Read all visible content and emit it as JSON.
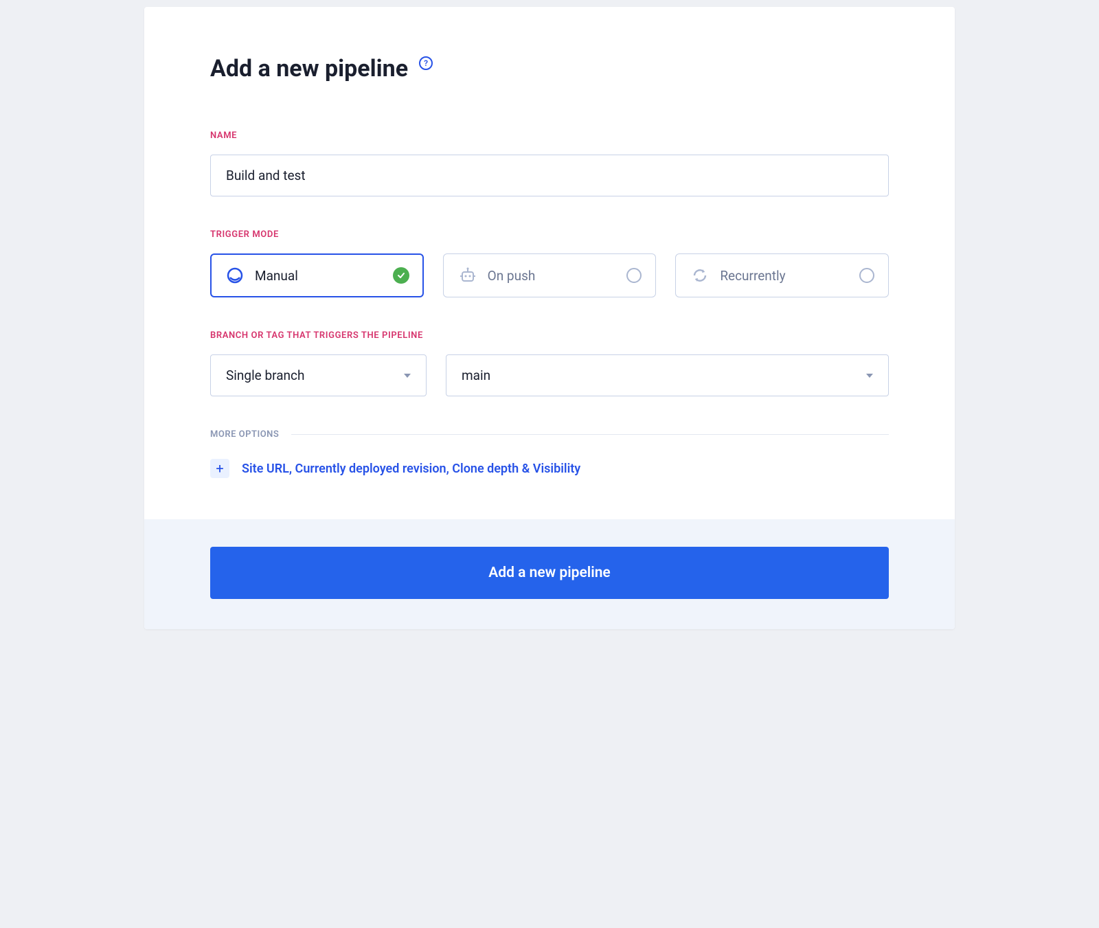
{
  "page_title": "Add a new pipeline",
  "sections": {
    "name": {
      "label": "NAME",
      "value": "Build and test"
    },
    "trigger_mode": {
      "label": "TRIGGER MODE",
      "options": [
        {
          "label": "Manual",
          "icon": "manual-icon",
          "selected": true
        },
        {
          "label": "On push",
          "icon": "robot-icon",
          "selected": false
        },
        {
          "label": "Recurrently",
          "icon": "sync-icon",
          "selected": false
        }
      ]
    },
    "branch": {
      "label": "BRANCH OR TAG THAT TRIGGERS THE PIPELINE",
      "scope_value": "Single branch",
      "branch_value": "main"
    },
    "more_options": {
      "label": "MORE OPTIONS",
      "expand_text": "Site URL, Currently deployed revision, Clone depth & Visibility"
    }
  },
  "submit_button": "Add a new pipeline"
}
